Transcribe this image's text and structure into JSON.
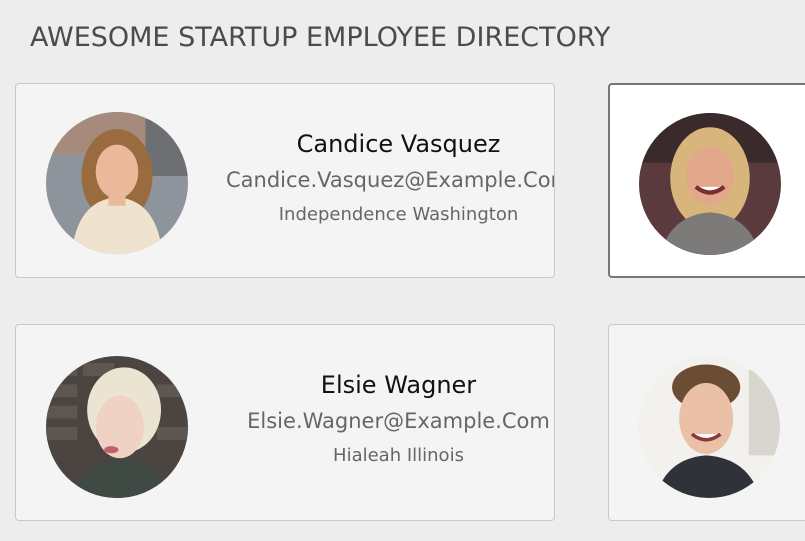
{
  "header": {
    "title": "AWESOME STARTUP EMPLOYEE DIRECTORY"
  },
  "employees": [
    {
      "name": "Candice Vasquez",
      "email": "Candice.Vasquez@Example.Com",
      "location": "Independence Washington",
      "avatar_icon": "woman-blonde-avatar"
    },
    {
      "name": "",
      "email": "",
      "location": "",
      "avatar_icon": "woman-smiling-avatar"
    },
    {
      "name": "Elsie Wagner",
      "email": "Elsie.Wagner@Example.Com",
      "location": "Hialeah Illinois",
      "avatar_icon": "woman-platinum-avatar"
    },
    {
      "name": "",
      "email": "",
      "location": "",
      "avatar_icon": "man-smiling-avatar"
    }
  ],
  "colors": {
    "background": "#ededed",
    "card": "#f4f4f4",
    "selected_card": "#ffffff"
  }
}
